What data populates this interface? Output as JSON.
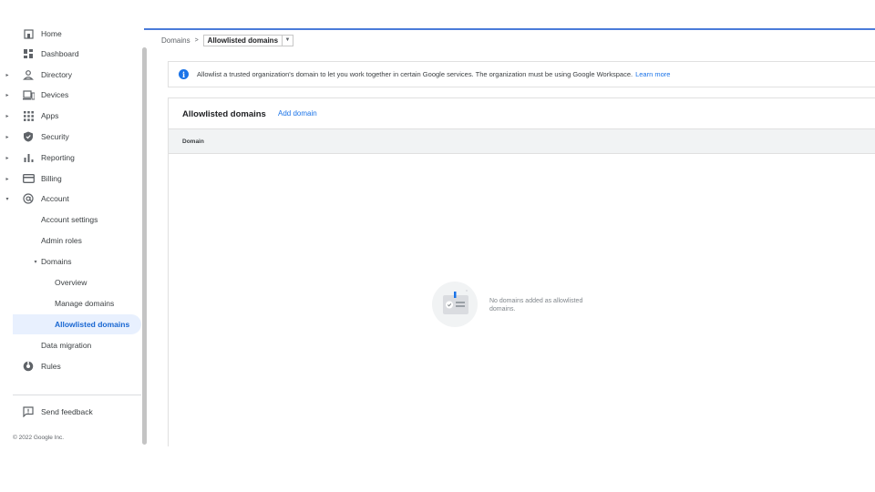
{
  "sidebar": {
    "items": [
      {
        "label": "Home",
        "icon": "home-icon",
        "caret": ""
      },
      {
        "label": "Dashboard",
        "icon": "dashboard-icon",
        "caret": ""
      },
      {
        "label": "Directory",
        "icon": "person-icon",
        "caret": "▸"
      },
      {
        "label": "Devices",
        "icon": "devices-icon",
        "caret": "▸"
      },
      {
        "label": "Apps",
        "icon": "apps-grid-icon",
        "caret": "▸"
      },
      {
        "label": "Security",
        "icon": "shield-icon",
        "caret": "▸"
      },
      {
        "label": "Reporting",
        "icon": "bar-chart-icon",
        "caret": "▸"
      },
      {
        "label": "Billing",
        "icon": "credit-card-icon",
        "caret": "▸"
      },
      {
        "label": "Account",
        "icon": "at-sign-icon",
        "caret": "▾"
      }
    ],
    "account_children": [
      {
        "label": "Account settings"
      },
      {
        "label": "Admin roles"
      },
      {
        "label": "Domains",
        "caret": "▾"
      }
    ],
    "domains_children": [
      {
        "label": "Overview"
      },
      {
        "label": "Manage domains"
      },
      {
        "label": "Allowlisted domains"
      }
    ],
    "data_migration": "Data migration",
    "rules": "Rules",
    "send_feedback": "Send feedback",
    "copyright": "© 2022 Google Inc."
  },
  "breadcrumb": {
    "parent": "Domains",
    "separator": ">",
    "current": "Allowlisted domains"
  },
  "banner": {
    "icon_text": "i",
    "text": "Allowlist a trusted organization's domain to let you work together in certain Google services. The organization must be using Google Workspace.",
    "link": "Learn more"
  },
  "card": {
    "title": "Allowlisted domains",
    "add_label": "Add domain",
    "columns": [
      "Domain"
    ],
    "empty_message": "No domains added as allowlisted domains."
  },
  "colors": {
    "accent": "#1a73e8",
    "active_bg": "#e8f0fe"
  }
}
